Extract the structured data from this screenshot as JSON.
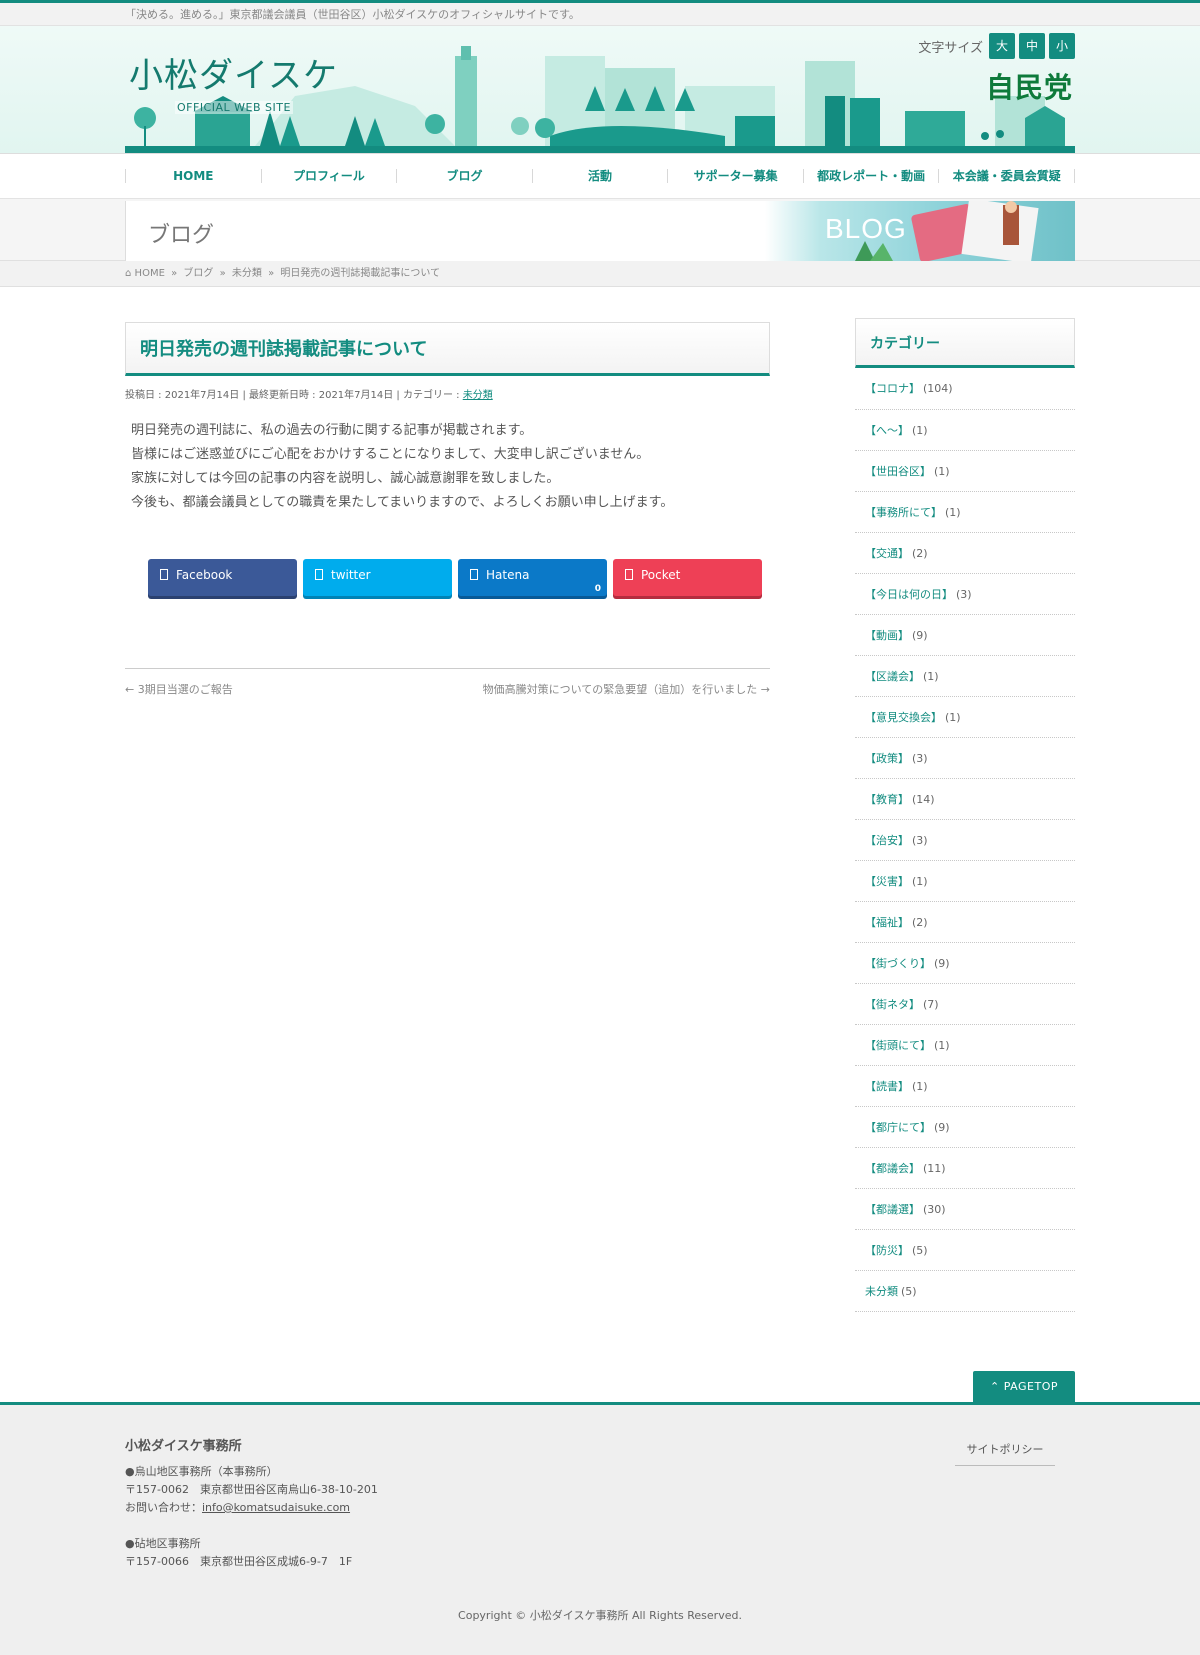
{
  "topbar": {
    "tagline": "「決める。進める。」東京都議会議員（世田谷区）小松ダイスケのオフィシャルサイトです。"
  },
  "header": {
    "logo": "小松ダイスケ",
    "logo_sub": "OFFICIAL WEB SITE",
    "fontsize_label": "文字サイズ",
    "fontsize_large": "大",
    "fontsize_medium": "中",
    "fontsize_small": "小",
    "party": "自民党",
    "brand_color": "#138c80"
  },
  "nav": {
    "items": [
      {
        "label": "HOME"
      },
      {
        "label": "プロフィール"
      },
      {
        "label": "ブログ"
      },
      {
        "label": "活動"
      },
      {
        "label": "サポーター募集"
      },
      {
        "label": "都政レポート・動画"
      },
      {
        "label": "本会議・委員会質疑"
      }
    ]
  },
  "page": {
    "title": "ブログ",
    "banner_word": "BLOG"
  },
  "breadcrumb": {
    "home": "HOME",
    "blog": "ブログ",
    "category": "未分類",
    "current": "明日発売の週刊誌掲載記事について",
    "sep": "»"
  },
  "post": {
    "title": "明日発売の週刊誌掲載記事について",
    "meta_prefix": "投稿日 : 2021年7月14日 | 最終更新日時 : 2021年7月14日 | カテゴリー : ",
    "meta_category": "未分類",
    "paragraphs": [
      "明日発売の週刊誌に、私の過去の行動に関する記事が掲載されます。",
      "皆様にはご迷惑並びにご心配をおかけすることになりまして、大変申し訳ございません。",
      "家族に対しては今回の記事の内容を説明し、誠心誠意謝罪を致しました。",
      "今後も、都議会議員としての職責を果たしてまいりますので、よろしくお願い申し上げます。"
    ],
    "share": {
      "facebook": "Facebook",
      "twitter": "twitter",
      "hatena": "Hatena",
      "hatena_count": "0",
      "pocket": "Pocket"
    },
    "prev": "← 3期目当選のご報告",
    "next": "物価高騰対策についての緊急要望（追加）を行いました →"
  },
  "sidebar": {
    "title": "カテゴリー",
    "categories": [
      {
        "name": "【コロナ】",
        "count": "(104)"
      },
      {
        "name": "【へ〜】",
        "count": "(1)"
      },
      {
        "name": "【世田谷区】",
        "count": "(1)"
      },
      {
        "name": "【事務所にて】",
        "count": "(1)"
      },
      {
        "name": "【交通】",
        "count": "(2)"
      },
      {
        "name": "【今日は何の日】",
        "count": "(3)"
      },
      {
        "name": "【動画】",
        "count": "(9)"
      },
      {
        "name": "【区議会】",
        "count": "(1)"
      },
      {
        "name": "【意見交換会】",
        "count": "(1)"
      },
      {
        "name": "【政策】",
        "count": "(3)"
      },
      {
        "name": "【教育】",
        "count": "(14)"
      },
      {
        "name": "【治安】",
        "count": "(3)"
      },
      {
        "name": "【災害】",
        "count": "(1)"
      },
      {
        "name": "【福祉】",
        "count": "(2)"
      },
      {
        "name": "【街づくり】",
        "count": "(9)"
      },
      {
        "name": "【街ネタ】",
        "count": "(7)"
      },
      {
        "name": "【街頭にて】",
        "count": "(1)"
      },
      {
        "name": "【読書】",
        "count": "(1)"
      },
      {
        "name": "【都庁にて】",
        "count": "(9)"
      },
      {
        "name": "【都議会】",
        "count": "(11)"
      },
      {
        "name": "【都議選】",
        "count": "(30)"
      },
      {
        "name": "【防災】",
        "count": "(5)"
      },
      {
        "name": "未分類",
        "count": "(5)"
      }
    ]
  },
  "pagetop": "PAGETOP",
  "footer": {
    "office_name": "小松ダイスケ事務所",
    "office1_title": "●烏山地区事務所（本事務所）",
    "office1_addr": "〒157-0062　東京都世田谷区南烏山6-38-10-201",
    "office1_contact_prefix": "お問い合わせ：",
    "office1_email": "info@komatsudaisuke.com",
    "office2_title": "●砧地区事務所",
    "office2_addr": "〒157-0066　東京都世田谷区成城6-9-7　1F",
    "policy": "サイトポリシー",
    "copyright": "Copyright © 小松ダイスケ事務所 All Rights Reserved."
  }
}
